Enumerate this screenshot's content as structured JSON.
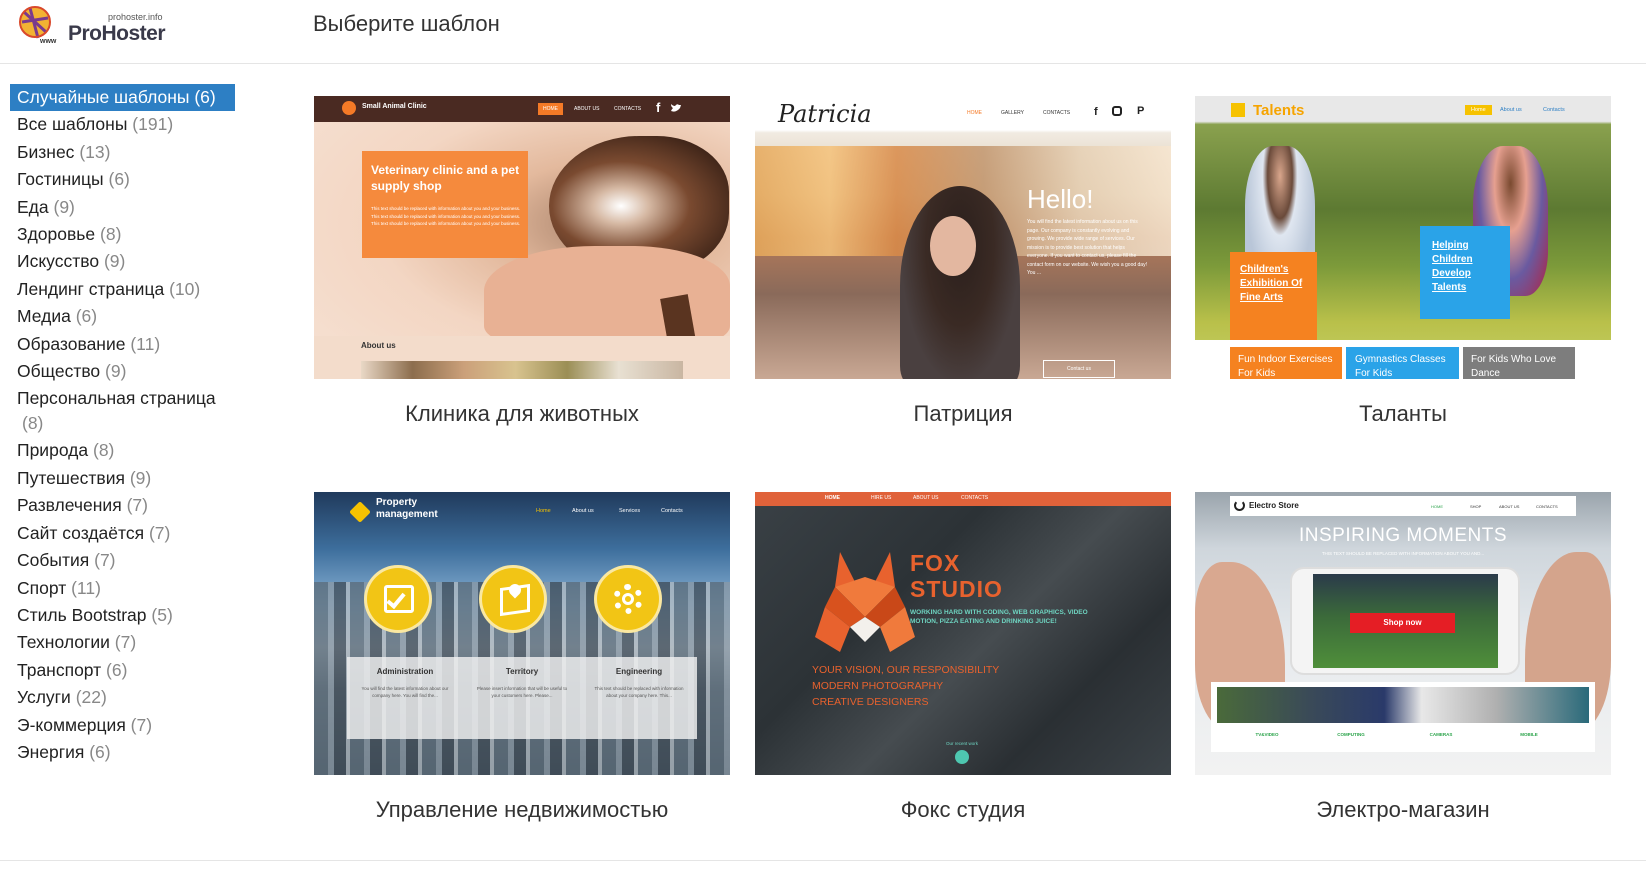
{
  "logo": {
    "small_text": "prohoster.info",
    "name": "ProHoster",
    "www": "www"
  },
  "page_title": "Выберите шаблон",
  "categories": [
    {
      "label": "Случайные шаблоны",
      "count": "(6)",
      "active": true
    },
    {
      "label": "Все шаблоны",
      "count": "(191)"
    },
    {
      "label": "Бизнес",
      "count": "(13)"
    },
    {
      "label": "Гостиницы",
      "count": "(6)"
    },
    {
      "label": "Еда",
      "count": "(9)"
    },
    {
      "label": "Здоровье",
      "count": "(8)"
    },
    {
      "label": "Искусство",
      "count": "(9)"
    },
    {
      "label": "Лендинг страница",
      "count": "(10)"
    },
    {
      "label": "Медиа",
      "count": "(6)"
    },
    {
      "label": "Образование",
      "count": "(11)"
    },
    {
      "label": "Общество",
      "count": "(9)"
    },
    {
      "label": "Персональная страница",
      "count": "(8)"
    },
    {
      "label": "Природа",
      "count": "(8)"
    },
    {
      "label": "Путешествия",
      "count": "(9)"
    },
    {
      "label": "Развлечения",
      "count": "(7)"
    },
    {
      "label": "Сайт создаётся",
      "count": "(7)"
    },
    {
      "label": "События",
      "count": "(7)"
    },
    {
      "label": "Спорт",
      "count": "(11)"
    },
    {
      "label": "Стиль Bootstrap",
      "count": "(5)"
    },
    {
      "label": "Технологии",
      "count": "(7)"
    },
    {
      "label": "Транспорт",
      "count": "(6)"
    },
    {
      "label": "Услуги",
      "count": "(22)"
    },
    {
      "label": "Э-коммерция",
      "count": "(7)"
    },
    {
      "label": "Энергия",
      "count": "(6)"
    }
  ],
  "templates": [
    {
      "label": "Клиника для животных",
      "thumb": {
        "brand": "Small Animal Clinic",
        "nav": [
          "HOME",
          "ABOUT US",
          "CONTACTS"
        ],
        "headline": "Veterinary clinic and a pet supply shop",
        "body": "This text should be replaced with information about you and your business. This text should be replaced with information about you and your business. This text should be replaced with information about you and your business.",
        "section": "About us"
      }
    },
    {
      "label": "Патриция",
      "thumb": {
        "brand": "Patricia",
        "nav": [
          "HOME",
          "GALLERY",
          "CONTACTS"
        ],
        "headline": "Hello!",
        "body": "You will find the latest information about us on this page. Our company is constantly evolving and growing. We provide wide range of services. Our mission is to provide best solution that helps everyone. If you want to contact us, please fill the contact form on our website. We wish you a good day! You ...",
        "button": "Contact us"
      }
    },
    {
      "label": "Таланты",
      "thumb": {
        "brand": "Talents",
        "nav": [
          "Home",
          "About us",
          "Contacts"
        ],
        "box1": "Children's Exhibition Of Fine Arts",
        "box2": "Helping Children Develop Talents",
        "tiles": [
          "Fun Indoor Exercises For Kids",
          "Gymnastics Classes For Kids",
          "For Kids Who Love Dance"
        ]
      }
    },
    {
      "label": "Управление недвижимостью",
      "thumb": {
        "brand": "Property management",
        "nav": [
          "Home",
          "About us",
          "Services",
          "Contacts"
        ],
        "columns": [
          {
            "title": "Administration",
            "text": "You will find the latest information about our company here. You will find the..."
          },
          {
            "title": "Territory",
            "text": "Please insert information that will be useful to your customers here. Please..."
          },
          {
            "title": "Engineering",
            "text": "This text should be replaced with information about your company here. This..."
          }
        ]
      }
    },
    {
      "label": "Фокс студия",
      "thumb": {
        "nav": [
          "HOME",
          "HIRE US",
          "ABOUT US",
          "CONTACTS"
        ],
        "title1": "FOX",
        "title2": "STUDIO",
        "tagline": "WORKING HARD WITH CODING, WEB GRAPHICS, VIDEO MOTION, PIZZA EATING AND DRINKING JUICE!",
        "lines": [
          "YOUR VISION, OUR RESPONSIBILITY",
          "MODERN PHOTOGRAPHY",
          "CREATIVE DESIGNERS"
        ],
        "recent": "Our recent work"
      }
    },
    {
      "label": "Электро-магазин",
      "thumb": {
        "brand": "Electro Store",
        "nav": [
          "HOME",
          "SHOP",
          "ABOUT US",
          "CONTACTS"
        ],
        "headline": "INSPIRING MOMENTS",
        "sub": "THIS TEXT SHOULD BE REPLACED WITH INFORMATION ABOUT YOU AND...",
        "button": "Shop now",
        "cats": [
          "TV&VIDEO",
          "COMPUTING",
          "CAMERAS",
          "MOBILE"
        ]
      }
    }
  ]
}
